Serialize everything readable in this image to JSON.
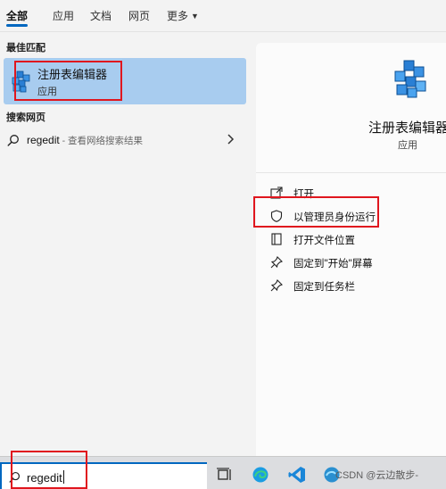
{
  "tabs": [
    {
      "label": "全部",
      "active": true
    },
    {
      "label": "应用",
      "active": false
    },
    {
      "label": "文档",
      "active": false
    },
    {
      "label": "网页",
      "active": false
    },
    {
      "label": "更多",
      "active": false
    }
  ],
  "best_match": {
    "heading": "最佳匹配",
    "app_name": "注册表编辑器",
    "app_type": "应用",
    "icon": "registry-editor-icon"
  },
  "web_search": {
    "heading": "搜索网页",
    "query": "regedit",
    "hint": " - 查看网络搜索结果"
  },
  "detail": {
    "app_name": "注册表编辑器",
    "app_type": "应用",
    "actions": [
      {
        "label": "打开",
        "icon": "open-icon"
      },
      {
        "label": "以管理员身份运行",
        "icon": "shield-icon"
      },
      {
        "label": "打开文件位置",
        "icon": "folder-open-icon"
      },
      {
        "label": "固定到\"开始\"屏幕",
        "icon": "pin-icon"
      },
      {
        "label": "固定到任务栏",
        "icon": "pin-icon"
      }
    ]
  },
  "taskbar": {
    "search_value": "regedit",
    "watermark": "CSDN @云边散步-"
  },
  "colors": {
    "accent": "#0067c0",
    "selection": "#a8ccef",
    "highlight_box": "#e0161e"
  }
}
